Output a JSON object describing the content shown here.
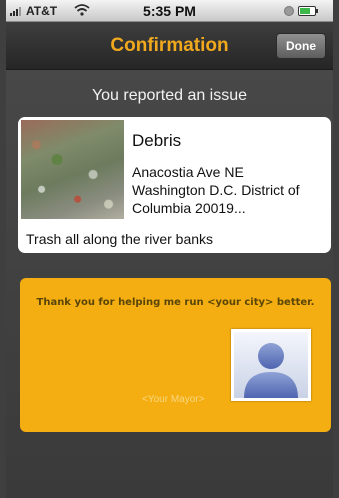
{
  "status_bar": {
    "carrier": "AT&T",
    "time": "5:35 PM",
    "battery_level": 0.7
  },
  "nav": {
    "title": "Confirmation",
    "done_label": "Done"
  },
  "heading": "You reported an issue",
  "issue": {
    "category": "Debris",
    "address_lines": [
      "Anacostia Ave NE",
      "Washington D.C. District of",
      "Columbia 20019..."
    ],
    "description": "Trash all along the river banks"
  },
  "mayor_card": {
    "thanks": "Thank you for helping me run <your city> better.",
    "mayor_name": "<Your Mayor>"
  },
  "colors": {
    "accent": "#f0a81e",
    "card_yellow": "#f5ae11"
  },
  "icons": [
    "signal-icon",
    "wifi-icon",
    "lock-icon",
    "battery-icon",
    "person-silhouette-icon"
  ]
}
